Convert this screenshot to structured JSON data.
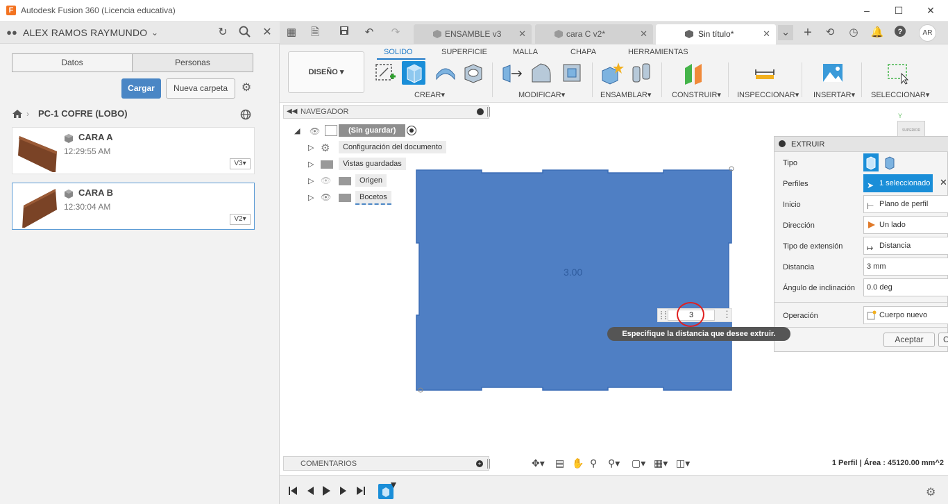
{
  "window": {
    "title": "Autodesk Fusion 360 (Licencia educativa)",
    "app_icon_letter": "F"
  },
  "data_panel": {
    "user": "ALEX RAMOS RAYMUNDO",
    "tabs": [
      "Datos",
      "Personas"
    ],
    "upload_label": "Cargar",
    "new_folder_label": "Nueva carpeta",
    "breadcrumb": "PC-1 COFRE (LOBO)",
    "items": [
      {
        "name": "CARA A",
        "time": "12:29:55 AM",
        "version": "V3"
      },
      {
        "name": "CARA B",
        "time": "12:30:04 AM",
        "version": "V2"
      }
    ]
  },
  "doc_tabs": [
    {
      "label": "ENSAMBLE v3",
      "active": false
    },
    {
      "label": "cara C v2*",
      "active": false
    },
    {
      "label": "Sin título*",
      "active": true
    }
  ],
  "user_initials": "AR",
  "ribbon": {
    "workspace": "DISEÑO",
    "tabs": [
      "SOLIDO",
      "SUPERFICIE",
      "MALLA",
      "CHAPA",
      "HERRAMIENTAS"
    ],
    "active_tab": "SOLIDO",
    "groups": [
      "CREAR",
      "MODIFICAR",
      "ENSAMBLAR",
      "CONSTRUIR",
      "INSPECCIONAR",
      "INSERTAR",
      "SELECCIONAR"
    ]
  },
  "navigator": {
    "title": "NAVEGADOR",
    "root": "(Sin guardar)",
    "nodes": [
      "Configuración del documento",
      "Vistas guardadas",
      "Origen",
      "Bocetos"
    ]
  },
  "canvas": {
    "dimension_label": "3.00",
    "input_value": "3",
    "tooltip": "Especifique la distancia que desee extruir."
  },
  "extrude": {
    "title": "EXTRUIR",
    "rows": [
      {
        "label": "Tipo",
        "value": ""
      },
      {
        "label": "Perfiles",
        "value": "1 seleccionado"
      },
      {
        "label": "Inicio",
        "value": "Plano de perfil"
      },
      {
        "label": "Dirección",
        "value": "Un lado"
      },
      {
        "label": "Tipo de extensión",
        "value": "Distancia"
      },
      {
        "label": "Distancia",
        "value": "3 mm"
      },
      {
        "label": "Ángulo de inclinación",
        "value": "0.0 deg"
      },
      {
        "label": "Operación",
        "value": "Cuerpo nuevo"
      }
    ],
    "ok_label": "Aceptar",
    "cancel_label": "Car"
  },
  "comments_label": "COMENTARIOS",
  "status": "1 Perfil | Área : 45120.00 mm^2",
  "colors": {
    "sketch_fill": "#4f7fc4",
    "accent": "#1f7ac8",
    "highlight": "#1a8ed8",
    "tooltip_bg": "#555555",
    "marker_red": "#e02020"
  }
}
